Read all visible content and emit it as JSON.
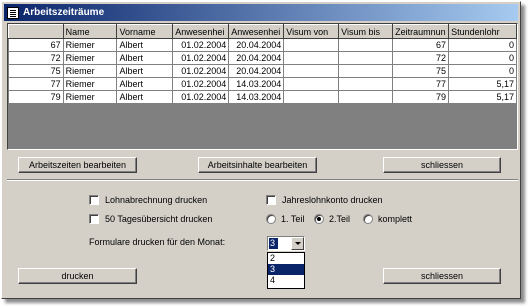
{
  "window": {
    "title": "Arbeitszeiträume"
  },
  "table": {
    "columns": [
      "Name",
      "Vorname",
      "Anwesenhei",
      "Anwesenhei",
      "Visum von",
      "Visum bis",
      "Zeitraumnun",
      "Stundenlohr"
    ],
    "rows": [
      {
        "row_id": "67",
        "cells": [
          "Riemer",
          "Albert",
          "01.02.2004",
          "20.04.2004",
          "",
          "",
          "67",
          "0"
        ]
      },
      {
        "row_id": "72",
        "cells": [
          "Riemer",
          "Albert",
          "01.02.2004",
          "20.04.2004",
          "",
          "",
          "72",
          "0"
        ]
      },
      {
        "row_id": "75",
        "cells": [
          "Riemer",
          "Albert",
          "01.02.2004",
          "20.04.2004",
          "",
          "",
          "75",
          "0"
        ]
      },
      {
        "row_id": "77",
        "cells": [
          "Riemer",
          "Albert",
          "01.02.2004",
          "14.03.2004",
          "",
          "",
          "77",
          "5,17"
        ]
      },
      {
        "row_id": "79",
        "cells": [
          "Riemer",
          "Albert",
          "01.02.2004",
          "14.03.2004",
          "",
          "",
          "79",
          "5,17"
        ]
      }
    ]
  },
  "buttons": {
    "arbeitszeiten": "Arbeitszeiten bearbeiten",
    "arbeitsinhalte": "Arbeitsinhalte bearbeiten",
    "schliessen_top": "schliessen",
    "drucken": "drucken",
    "schliessen_bottom": "schliessen"
  },
  "options": {
    "lohnabrechnung": {
      "label": "Lohnabrechnung drucken",
      "checked": false
    },
    "jahreslohnkonto": {
      "label": "Jahreslohnkonto drucken",
      "checked": false
    },
    "tagesuebersicht": {
      "label": "50 Tagesübersicht drucken",
      "checked": false
    },
    "teil": {
      "items": [
        {
          "label": "1. Teil",
          "selected": false
        },
        {
          "label": "2.Teil",
          "selected": true
        },
        {
          "label": "komplett",
          "selected": false
        }
      ]
    },
    "monat": {
      "label": "Formulare drucken für den Monat:",
      "value": "3",
      "choices": [
        "2",
        "3",
        "4"
      ]
    }
  },
  "colors": {
    "title_start": "#0a246a",
    "title_end": "#a6caf0",
    "face": "#d4d0c8",
    "selection": "#0a246a"
  }
}
